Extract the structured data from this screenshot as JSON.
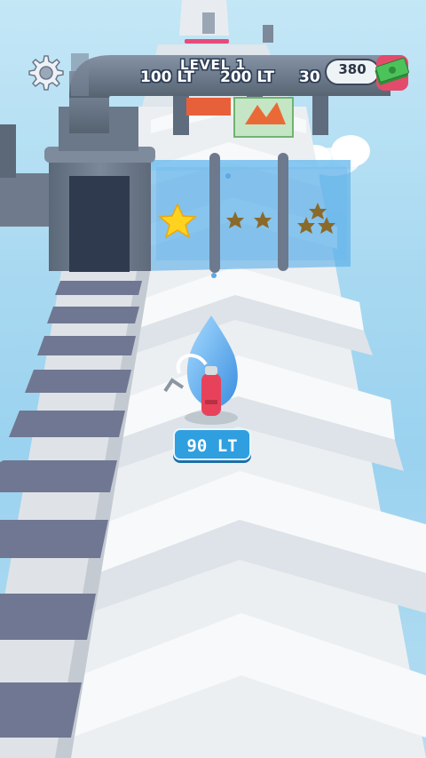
{
  "hud": {
    "level_title": "LEVEL 1",
    "money_value": "380",
    "money_icon": "cash-stack-icon",
    "settings_icon": "gear-icon"
  },
  "track_markers": [
    {
      "label": "100 LT"
    },
    {
      "label": "200 LT"
    },
    {
      "label": "30"
    }
  ],
  "player": {
    "volume_label": "90 LT"
  },
  "colors": {
    "sky": "#a9d9f1",
    "track": "#f2f4f6",
    "rail_stripe": "#6f7690",
    "pipe": "#6f7c8e",
    "water": "#4aa6e6",
    "star_gold": "#ffd21f",
    "star_bronze": "#8a6a2a",
    "label_bg": "#2f9fe0",
    "money_bg": "#e24b6b"
  }
}
